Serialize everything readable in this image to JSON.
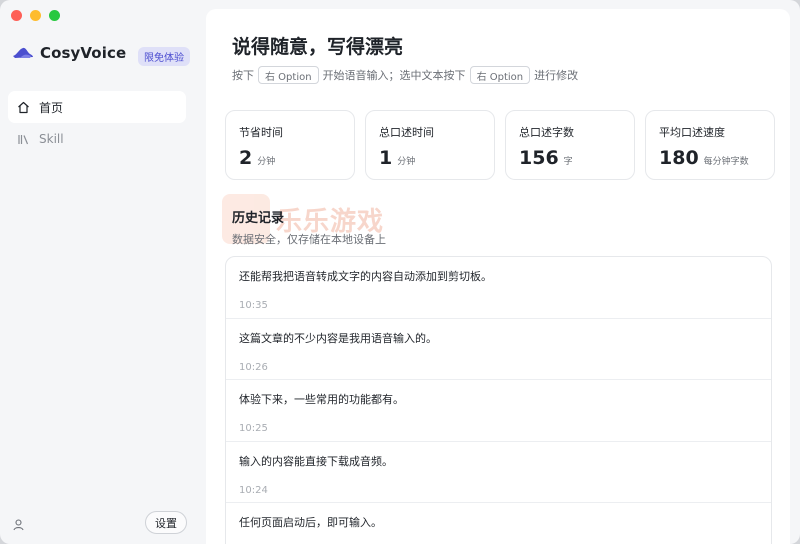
{
  "brand": {
    "name": "CosyVoice",
    "badge": "限免体验"
  },
  "nav": [
    {
      "label": "首页",
      "icon": "home-icon"
    },
    {
      "label": "Skill",
      "icon": "library-icon"
    }
  ],
  "footer": {
    "settings_label": "设置",
    "user_icon": "user-icon"
  },
  "main": {
    "title": "说得随意，写得漂亮",
    "hint": {
      "press": "按下",
      "key1": "右 Option",
      "after_key1": "开始语音输入；选中文本按下",
      "key2": "右 Option",
      "after_key2": "进行修改"
    }
  },
  "stats": [
    {
      "label": "节省时间",
      "value": "2",
      "unit": "分钟"
    },
    {
      "label": "总口述时间",
      "value": "1",
      "unit": "分钟"
    },
    {
      "label": "总口述字数",
      "value": "156",
      "unit": "字"
    },
    {
      "label": "平均口述速度",
      "value": "180",
      "unit": "每分钟字数"
    }
  ],
  "history": {
    "title": "历史记录",
    "subtitle": "数据安全，仅存储在本地设备上",
    "items": [
      {
        "text": "还能帮我把语音转成文字的内容自动添加到剪切板。",
        "time": "10:35"
      },
      {
        "text": "这篇文章的不少内容是我用语音输入的。",
        "time": "10:26"
      },
      {
        "text": "体验下来，一些常用的功能都有。",
        "time": "10:25"
      },
      {
        "text": "输入的内容能直接下载成音频。",
        "time": "10:24"
      },
      {
        "text": "任何页面启动后，即可输入。",
        "time": ""
      }
    ]
  },
  "watermark": {
    "text": "乐乐游戏"
  },
  "colors": {
    "accent": "#4a4bd0",
    "badge_bg": "#dfe0f8",
    "sidebar_bg": "#f5f6f8"
  }
}
